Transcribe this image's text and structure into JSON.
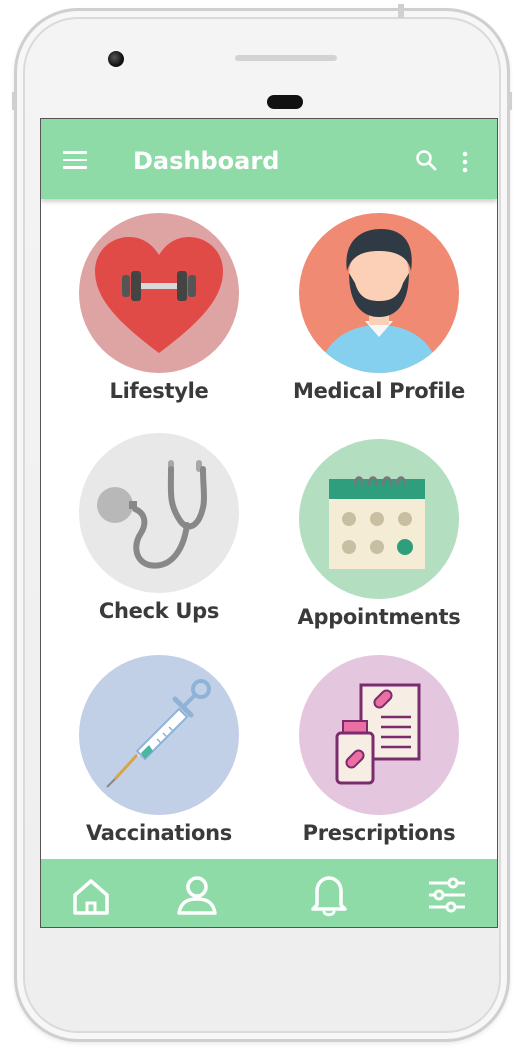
{
  "appbar": {
    "title": "Dashboard",
    "menu_icon": "hamburger-menu-icon",
    "search_icon": "search-icon",
    "more_icon": "more-vertical-icon"
  },
  "tiles": [
    {
      "label": "Lifestyle",
      "icon": "heart-dumbbell-icon",
      "circle_color": "#dea3a3"
    },
    {
      "label": "Medical Profile",
      "icon": "doctor-avatar-icon",
      "circle_color": "#f08a72"
    },
    {
      "label": "Check Ups",
      "icon": "stethoscope-icon",
      "circle_color": "#e8e8e8"
    },
    {
      "label": "Appointments",
      "icon": "calendar-icon",
      "circle_color": "#b3dec0"
    },
    {
      "label": "Vaccinations",
      "icon": "syringe-icon",
      "circle_color": "#c1d0e6"
    },
    {
      "label": "Prescriptions",
      "icon": "prescription-medicine-icon",
      "circle_color": "#e4c7de"
    }
  ],
  "bottom_nav": [
    {
      "icon": "home-icon"
    },
    {
      "icon": "user-icon"
    },
    {
      "icon": "bell-icon"
    },
    {
      "icon": "settings-sliders-icon"
    }
  ],
  "colors": {
    "accent": "#8edba8",
    "header_text": "#ffffff",
    "label_text": "#3a3a3a"
  }
}
